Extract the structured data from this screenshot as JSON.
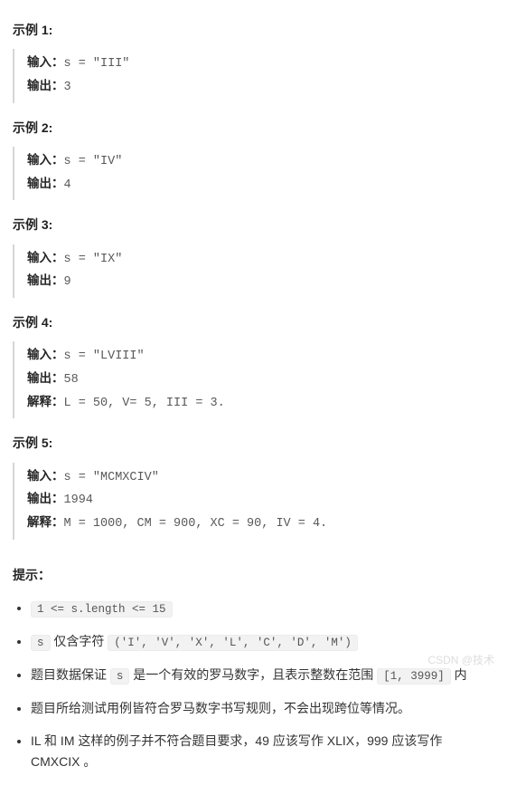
{
  "labels": {
    "input": "输入：",
    "output": "输出：",
    "explain": "解释："
  },
  "examples": [
    {
      "title": "示例 1:",
      "input": "s = \"III\"",
      "output": "3"
    },
    {
      "title": "示例 2:",
      "input": "s = \"IV\"",
      "output": "4"
    },
    {
      "title": "示例 3:",
      "input": "s = \"IX\"",
      "output": "9"
    },
    {
      "title": "示例 4:",
      "input": "s = \"LVIII\"",
      "output": "58",
      "explain": "L = 50, V= 5, III = 3."
    },
    {
      "title": "示例 5:",
      "input": "s = \"MCMXCIV\"",
      "output": "1994",
      "explain": "M = 1000, CM = 900, XC = 90, IV = 4."
    }
  ],
  "hints": {
    "heading": "提示：",
    "items": [
      {
        "code": "1 <= s.length <= 15"
      },
      {
        "prefix": "s",
        "mid": " 仅含字符 ",
        "code2": "('I', 'V', 'X', 'L', 'C', 'D', 'M')"
      },
      {
        "t1": "题目数据保证 ",
        "c1": "s",
        "t2": " 是一个有效的罗马数字，且表示整数在范围 ",
        "c2": "[1, 3999]",
        "t3": " 内"
      },
      {
        "plain": "题目所给测试用例皆符合罗马数字书写规则，不会出现跨位等情况。"
      },
      {
        "plain": "IL 和 IM 这样的例子并不符合题目要求，49 应该写作 XLIX，999 应该写作 CMXCIX 。"
      }
    ]
  },
  "watermark": "CSDN @技术"
}
